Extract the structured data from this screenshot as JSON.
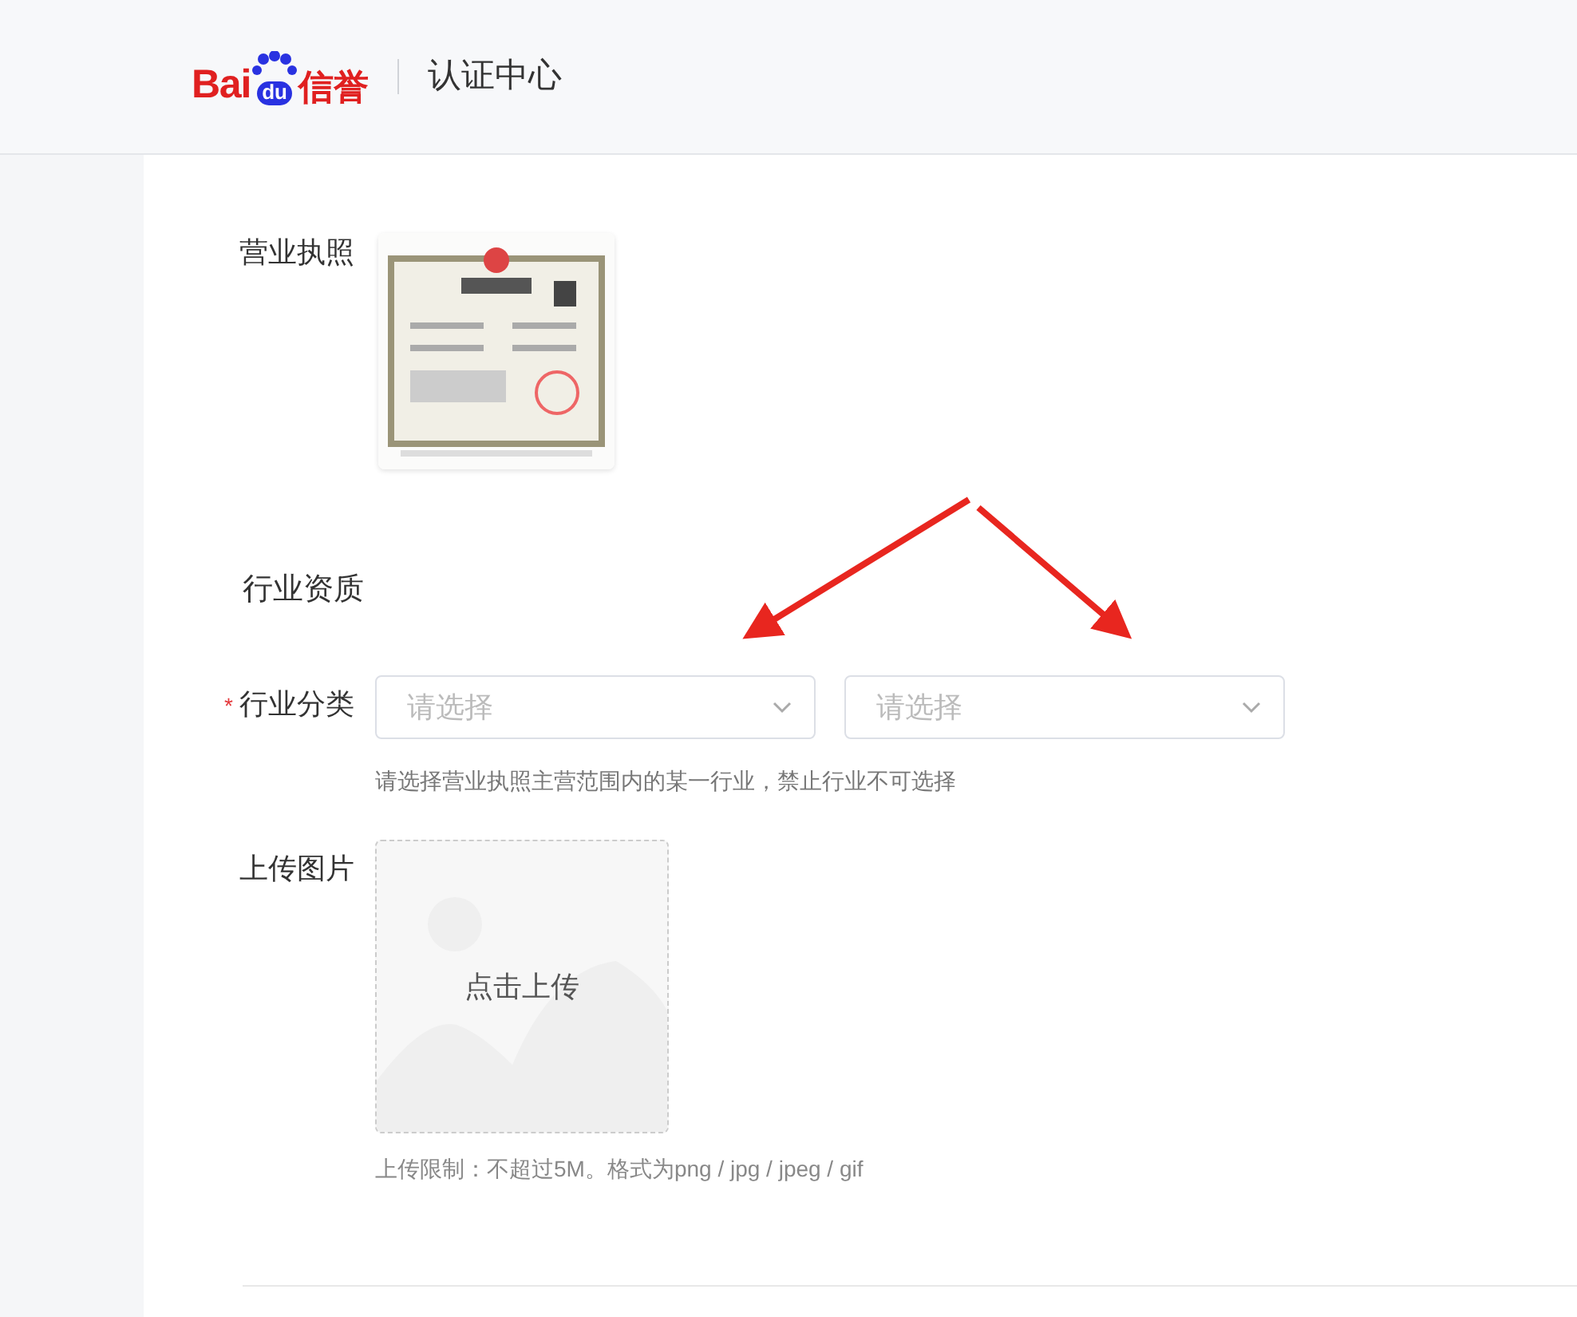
{
  "header": {
    "logo": {
      "brand": "Bai",
      "badge": "du",
      "suffix": "信誉"
    },
    "title": "认证中心"
  },
  "license_row": {
    "label": "营业执照"
  },
  "section_title": "行业资质",
  "industry_row": {
    "label": "行业分类",
    "required_mark": "*",
    "selects": [
      {
        "placeholder": "请选择"
      },
      {
        "placeholder": "请选择"
      }
    ],
    "hint": "请选择营业执照主营范围内的某一行业，禁止行业不可选择"
  },
  "upload_row": {
    "label": "上传图片",
    "button": "点击上传",
    "hint": "上传限制：不超过5M。格式为png / jpg / jpeg / gif"
  }
}
